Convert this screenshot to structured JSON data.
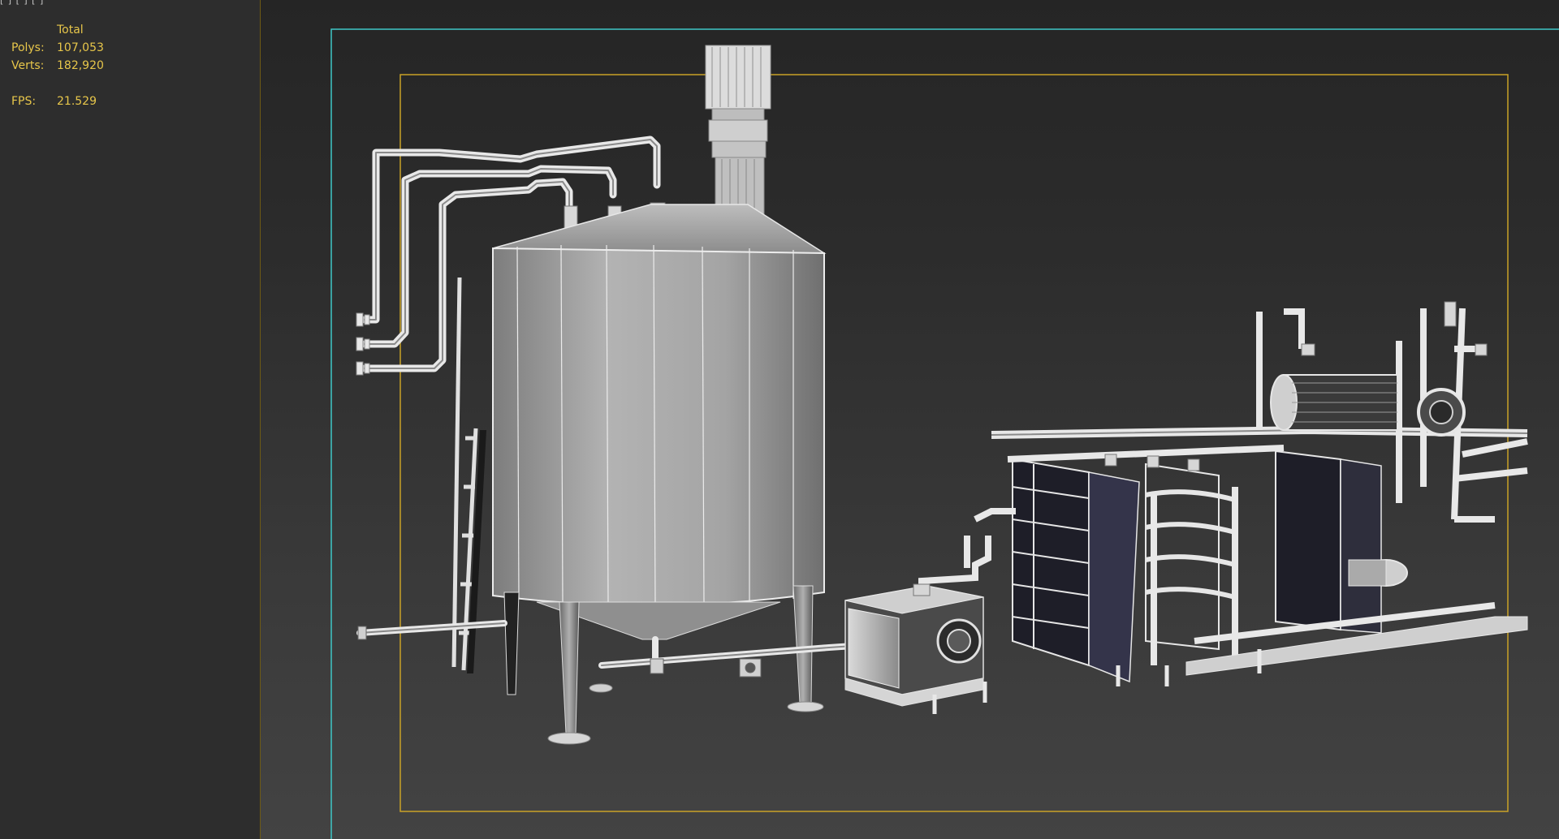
{
  "app": {
    "menu_fragment": "[ ] [ ] [ ]"
  },
  "stats": {
    "header": "Total",
    "polys_label": "Polys:",
    "polys_value": "107,053",
    "verts_label": "Verts:",
    "verts_value": "182,920",
    "fps_label": "FPS:",
    "fps_value": "21.529"
  },
  "colors": {
    "stats_text": "#e7c64a",
    "safe_frame_outer": "#3ec7c7",
    "safe_frame_inner": "#c9a227",
    "model_wire": "#e8e8e8",
    "model_shade": "#9a9a9a"
  },
  "viewport": {
    "shading_mode": "edged-faces",
    "scene": "industrial-tank-and-heat-exchanger-model"
  }
}
